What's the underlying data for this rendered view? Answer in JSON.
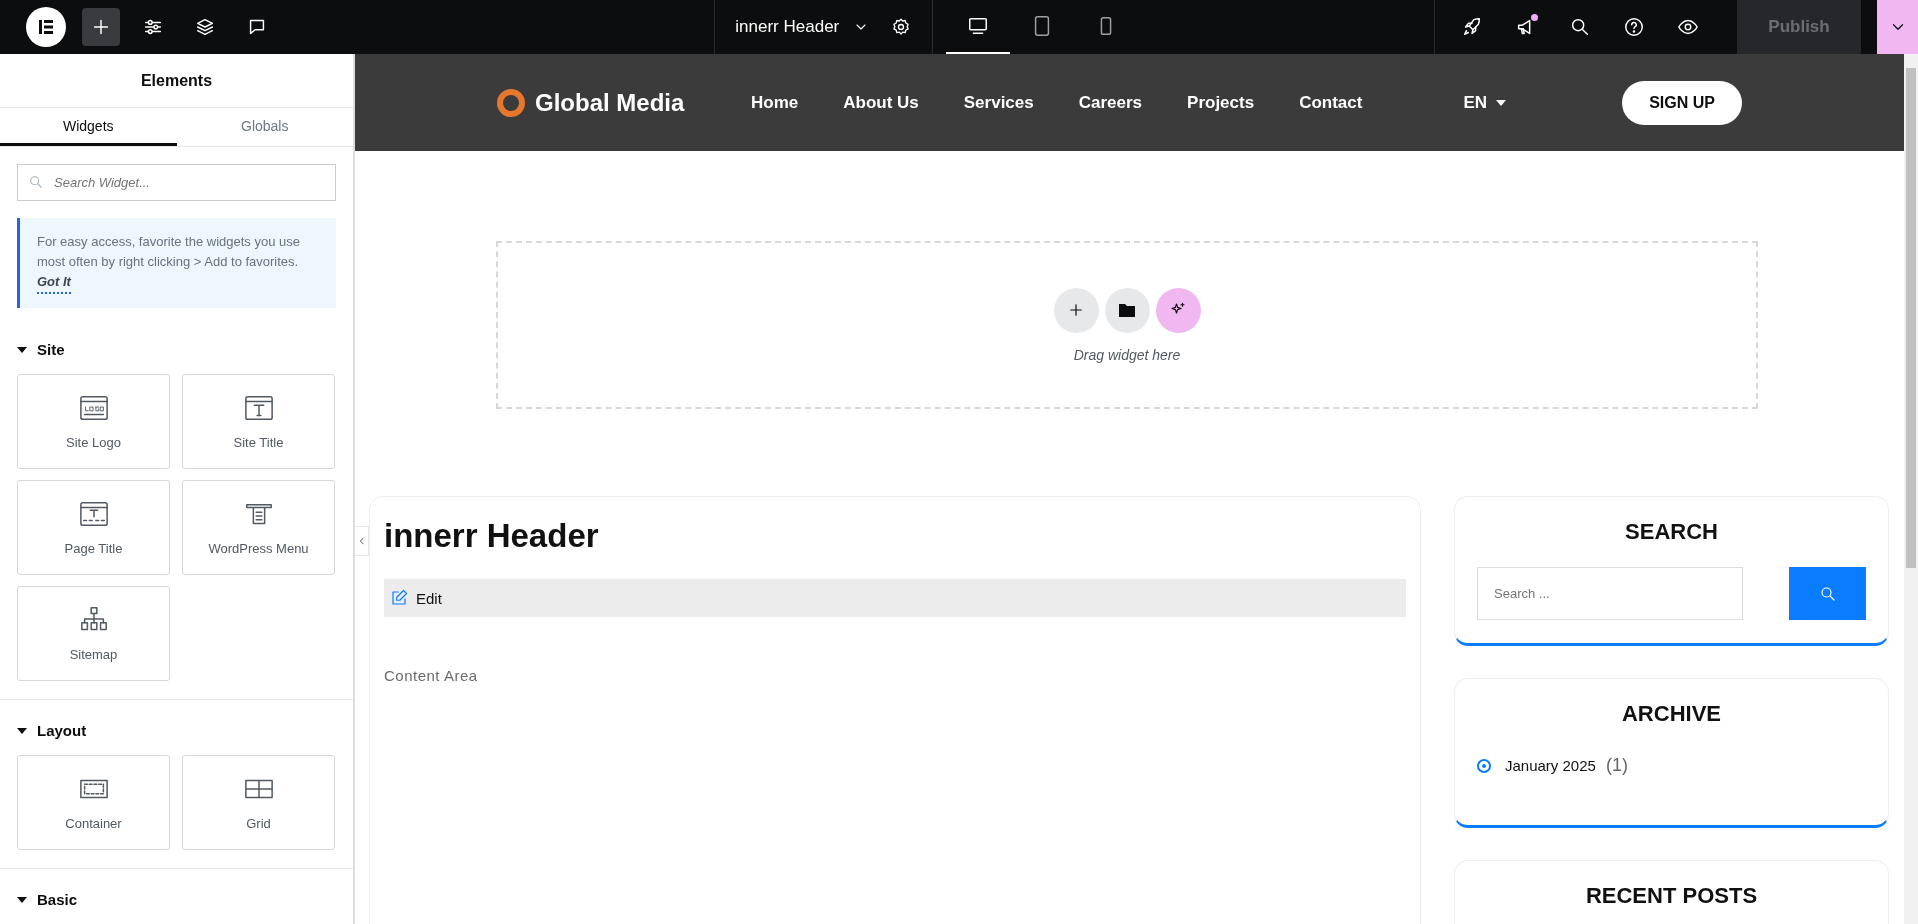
{
  "top_bar": {
    "left_tools": [
      {
        "kind": "add",
        "selected": true
      },
      {
        "kind": "settings",
        "selected": false
      },
      {
        "kind": "layers",
        "selected": false
      },
      {
        "kind": "comments",
        "selected": false
      }
    ],
    "document_title": "innerr Header",
    "devices": [
      {
        "kind": "desktop",
        "selected": true
      },
      {
        "kind": "tablet",
        "selected": false
      },
      {
        "kind": "mobile",
        "selected": false
      }
    ],
    "right_tools": [
      {
        "kind": "rocket",
        "badge": false
      },
      {
        "kind": "megaphone",
        "badge": true
      },
      {
        "kind": "search",
        "badge": false
      },
      {
        "kind": "help",
        "badge": false
      },
      {
        "kind": "preview",
        "badge": false
      }
    ],
    "publish": {
      "label": "Publish",
      "disabled": true
    }
  },
  "panel": {
    "title": "Elements",
    "tabs": [
      {
        "label": "Widgets",
        "selected": true
      },
      {
        "label": "Globals",
        "selected": false
      }
    ],
    "search": {
      "placeholder": "Search Widget..."
    },
    "tip": {
      "text": "For easy access, favorite the widgets you use most often by right clicking > Add to favorites.",
      "link": "Got It"
    },
    "categories": [
      {
        "name": "Site",
        "expanded": true,
        "widgets": [
          {
            "kind": "logo",
            "label": "Site Logo"
          },
          {
            "kind": "title",
            "label": "Site Title"
          },
          {
            "kind": "page-title",
            "label": "Page Title"
          },
          {
            "kind": "menu",
            "label": "WordPress Menu"
          },
          {
            "kind": "sitemap",
            "label": "Sitemap"
          }
        ]
      },
      {
        "name": "Layout",
        "expanded": true,
        "widgets": [
          {
            "kind": "container",
            "label": "Container"
          },
          {
            "kind": "grid",
            "label": "Grid"
          }
        ]
      },
      {
        "name": "Basic",
        "expanded": true
      }
    ]
  },
  "preview": {
    "site_header": {
      "logo_text": "Global Media",
      "nav": [
        "Home",
        "About Us",
        "Services",
        "Careers",
        "Projects",
        "Contact"
      ],
      "language": "EN",
      "cta": "SIGN UP"
    },
    "drop_zone": {
      "hint": "Drag widget here",
      "buttons": [
        {
          "kind": "add"
        },
        {
          "kind": "template"
        },
        {
          "kind": "ai"
        }
      ]
    },
    "content": {
      "title": "innerr Header",
      "edit": "Edit",
      "body": "Content Area"
    },
    "sidebar": [
      {
        "kind": "search",
        "title": "SEARCH",
        "placeholder": "Search ..."
      },
      {
        "kind": "archive",
        "title": "ARCHIVE",
        "items": [
          {
            "label": "January 2025",
            "count": "(1)"
          }
        ]
      },
      {
        "kind": "recent",
        "title": "RECENT POSTS"
      }
    ]
  }
}
